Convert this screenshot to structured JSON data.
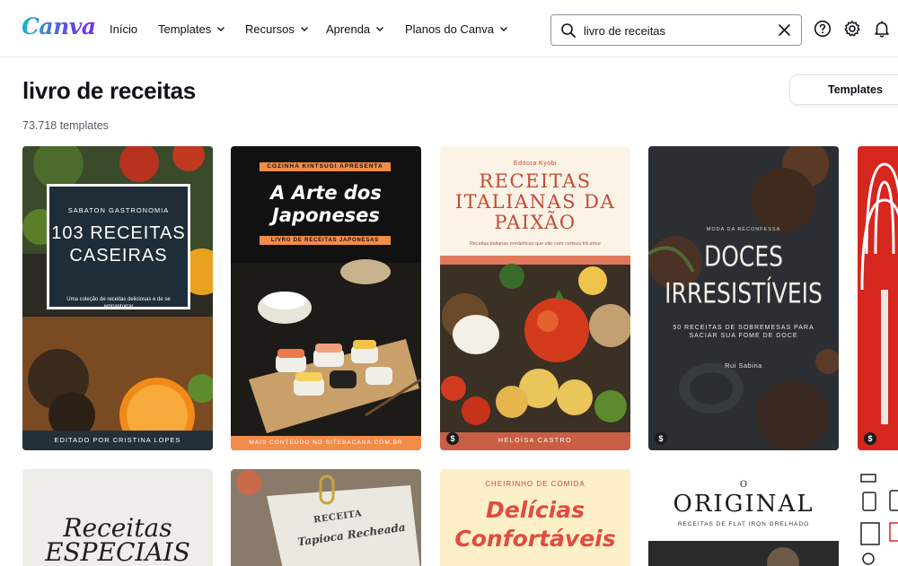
{
  "header": {
    "logo": "Canva",
    "nav": [
      {
        "label": "Início",
        "has_dropdown": false
      },
      {
        "label": "Templates",
        "has_dropdown": true
      },
      {
        "label": "Recursos",
        "has_dropdown": true
      },
      {
        "label": "Aprenda",
        "has_dropdown": true
      },
      {
        "label": "Planos do Canva",
        "has_dropdown": true
      }
    ],
    "search": {
      "value": "livro de receitas",
      "icon": "search-icon",
      "clear_icon": "close-icon"
    },
    "icons": [
      "help-icon",
      "gear-icon",
      "bell-icon"
    ]
  },
  "page": {
    "title": "livro de receitas",
    "count": "73.718 templates",
    "filter_tab": "Templates"
  },
  "cards": [
    {
      "brand": "SABATON GASTRONOMIA",
      "title": "103 RECEITAS CASEIRAS",
      "subtitle": "Uma coleção de receitas deliciosas e de se empanturrar",
      "footer": "EDITADO POR CRISTINA LOPES",
      "premium": false
    },
    {
      "kicker": "COZINHA KINTSUGI APRESENTA",
      "title": "A Arte dos Japoneses",
      "strip": "LIVRO DE RECEITAS JAPONESAS",
      "footer": "MAIS CONTEÚDO NO SITEBACANA.COM.BR",
      "premium": false
    },
    {
      "publisher": "Editora Kyobi",
      "title": "RECEITAS ITALIANAS DA PAIXÃO",
      "subtitle": "Receitas italianas românticas que vão com certeza trã amur",
      "footer": "HELOÍSA CASTRO",
      "premium": true,
      "badge": "$"
    },
    {
      "kicker": "MODA DA RECONFESSA",
      "title": "DOCES IRRESISTÍVEIS",
      "subtitle": "50 RECEITAS DE SOBREMESAS PARA SACIAR SUA FOME DE DOCE",
      "author": "Rui Sabina",
      "premium": true,
      "badge": "$"
    },
    {
      "premium": true,
      "badge": "$"
    },
    {
      "title": "Receitas ESPECIAIS"
    },
    {
      "label": "RECEITA",
      "title": "Tapioca Recheada"
    },
    {
      "kicker": "CHEIRINHO DE COMIDA",
      "title": "Delícias Confortáveis"
    },
    {
      "prefix": "O",
      "title": "ORIGINAL",
      "subtitle": "RECEITAS DE FLAT IRON GRELHADO"
    },
    {}
  ],
  "colors": {
    "canva_teal": "#19b7c8",
    "canva_purple": "#7d2ae8",
    "text_primary": "#0e1318",
    "text_secondary": "#555d66",
    "border": "#8a949e"
  }
}
